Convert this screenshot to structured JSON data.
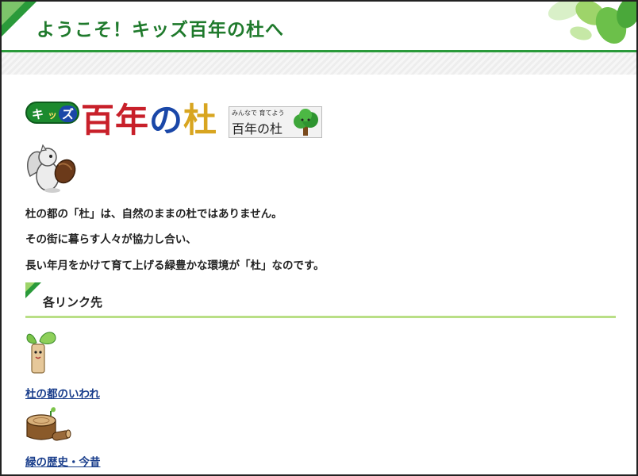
{
  "header": {
    "title": "ようこそ！キッズ百年の杜へ"
  },
  "logo": {
    "badge": [
      "キ",
      "ッ",
      "ズ"
    ],
    "main": [
      "百",
      "年",
      "の",
      "杜"
    ],
    "tag_small": "みんなで 育てよう",
    "tag_name": "百年の杜"
  },
  "intro": {
    "line1": "杜の都の「杜」は、自然のままの杜ではありません。",
    "line2": "その街に暮らす人々が協力し合い、",
    "line3": "長い年月をかけて育て上げる緑豊かな環境が「杜」なのです。"
  },
  "section": {
    "heading": "各リンク先"
  },
  "links": [
    {
      "label": "杜の都のいわれ",
      "icon": "sprout-character-icon"
    },
    {
      "label": "緑の歴史・今昔",
      "icon": "tree-stump-icon"
    }
  ],
  "colors": {
    "accent_green": "#2a9a3a",
    "title_green": "#1f7a2c",
    "link_blue": "#1a3e8c",
    "section_line": "#b9df86"
  }
}
